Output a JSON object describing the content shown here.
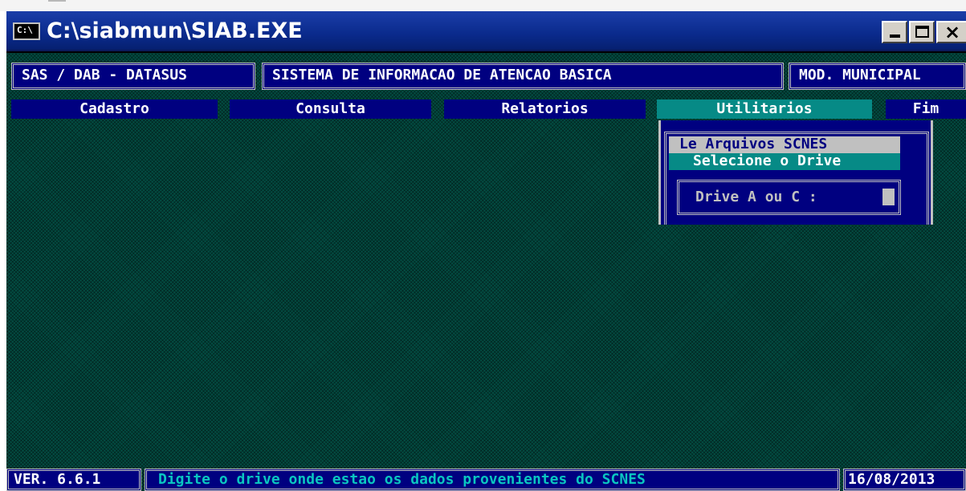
{
  "window": {
    "title": "C:\\siabmun\\SIAB.EXE",
    "icon": "console-icon",
    "icon_text": "C:\\",
    "controls": {
      "minimize": "minimize",
      "maximize": "maximize",
      "close": "×"
    }
  },
  "header": {
    "org": "SAS / DAB - DATASUS",
    "system": "SISTEMA DE INFORMACAO DE ATENCAO BASICA",
    "module": "MOD. MUNICIPAL"
  },
  "menu": {
    "items": [
      {
        "label": "Cadastro"
      },
      {
        "label": "Consulta"
      },
      {
        "label": "Relatorios"
      },
      {
        "label": "Utilitarios",
        "active": true
      },
      {
        "label": "Fim"
      }
    ]
  },
  "dropdown": {
    "option1": "Le Arquivos SCNES",
    "option2": "Selecione o Drive",
    "field_label": "Drive A ou C  :",
    "field_value": ""
  },
  "status": {
    "version": "VER. 6.6.1",
    "message": "Digite o drive onde estao os dados provenientes do SCNES",
    "date": "16/08/2013"
  },
  "colors": {
    "background": "#034c42",
    "panel": "#000080",
    "highlight": "#068a86",
    "text_light": "#c0c0c0",
    "status_text": "#0ac6c0"
  }
}
